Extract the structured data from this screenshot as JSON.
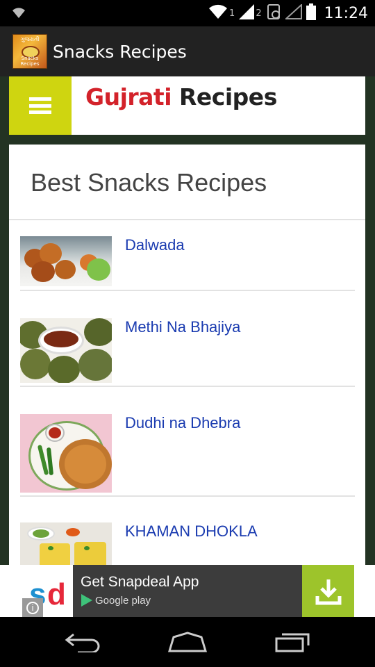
{
  "status_bar": {
    "sim1_label": "1",
    "sim2_label": "2",
    "time": "11:24"
  },
  "action_bar": {
    "app_title": "Snacks Recipes",
    "logo_top_text": "ગુજરાતી",
    "logo_bottom_text": "Snacks Recipes"
  },
  "site_header": {
    "logo_word1": "Gujrati",
    "logo_word2": " Recipes"
  },
  "content": {
    "section_title": "Best Snacks Recipes",
    "recipes": [
      {
        "name": "Dalwada"
      },
      {
        "name": "Methi Na Bhajiya"
      },
      {
        "name": "Dudhi na Dhebra"
      },
      {
        "name": "KHAMAN DHOKLA"
      }
    ]
  },
  "ad": {
    "logo_s": "s",
    "logo_d": "d",
    "title": "Get Snapdeal App",
    "store": "Google play",
    "info": "i"
  },
  "colors": {
    "menu_button": "#cfd510",
    "link": "#1a3bb0",
    "ad_download": "#9dc42b",
    "page_background": "#233323"
  }
}
